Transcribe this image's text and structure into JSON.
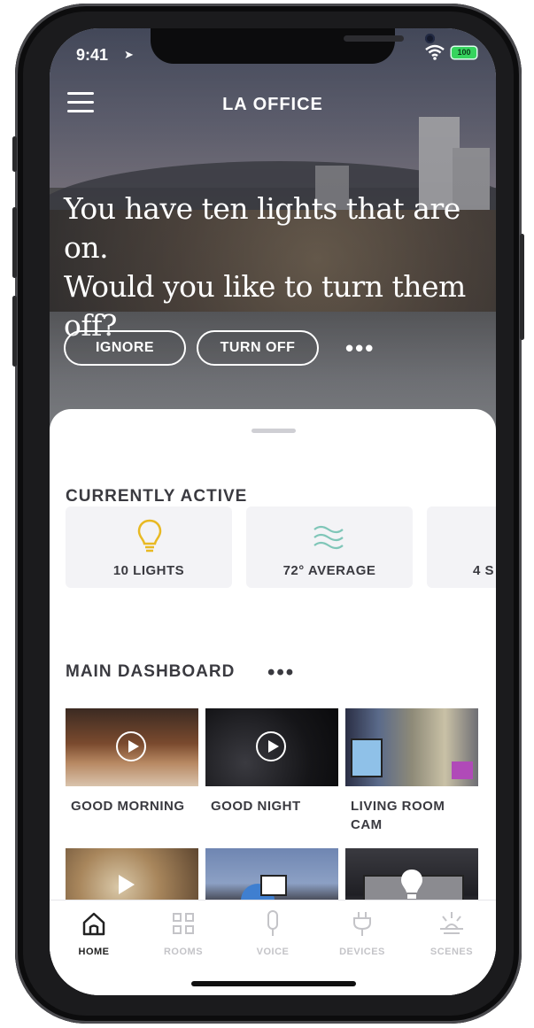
{
  "status_bar": {
    "time": "9:41",
    "battery": "100"
  },
  "header": {
    "title": "LA OFFICE"
  },
  "hero": {
    "message_lines": [
      "You have ten lights that are on.",
      "Would you like to turn them",
      "off?"
    ],
    "ignore_label": "IGNORE",
    "turn_off_label": "TURN OFF",
    "more_label": "•••"
  },
  "currently_active": {
    "title": "CURRENTLY ACTIVE",
    "items": [
      {
        "label": "10 LIGHTS",
        "icon": "lightbulb-icon"
      },
      {
        "label": "72° AVERAGE",
        "icon": "heat-waves-icon"
      },
      {
        "label": "4 S",
        "icon": ""
      }
    ]
  },
  "main_dashboard": {
    "title": "MAIN DASHBOARD",
    "more_label": "•••",
    "tiles": [
      {
        "label": "GOOD MORNING"
      },
      {
        "label": "GOOD NIGHT"
      },
      {
        "label": "LIVING ROOM CAM"
      }
    ]
  },
  "tabbar": {
    "tabs": [
      {
        "label": "HOME",
        "active": true
      },
      {
        "label": "ROOMS",
        "active": false
      },
      {
        "label": "VOICE",
        "active": false
      },
      {
        "label": "DEVICES",
        "active": false
      },
      {
        "label": "SCENES",
        "active": false
      }
    ]
  },
  "colors": {
    "accent": "#e8b923",
    "text": "#3a3a40",
    "inactive": "#c4c4c8"
  }
}
